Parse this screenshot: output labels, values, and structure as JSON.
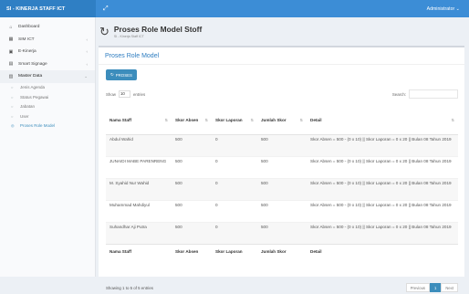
{
  "brand": "SI - KINERJA STAFF ICT",
  "navbar": {
    "toggle": "⤢",
    "user": "Administrator"
  },
  "sidebar": {
    "items": [
      {
        "label": "Dashboard",
        "icon": "home-icon",
        "glyph": "⌂"
      },
      {
        "label": "SIM ICT",
        "icon": "grid-icon",
        "glyph": "▦",
        "arrow": "‹"
      },
      {
        "label": "E-Kinerja",
        "icon": "chart-icon",
        "glyph": "▣",
        "arrow": "‹"
      },
      {
        "label": "Smart Signage",
        "icon": "monitor-icon",
        "glyph": "▤",
        "arrow": "‹"
      },
      {
        "label": "Master Data",
        "icon": "table-icon",
        "glyph": "▥",
        "arrow": "⌄"
      }
    ],
    "subitems": [
      {
        "label": "Jenis Agenda",
        "glyph": "○"
      },
      {
        "label": "Status Pegawai",
        "glyph": "○"
      },
      {
        "label": "Jabatan",
        "glyph": "○"
      },
      {
        "label": "User",
        "glyph": "○"
      },
      {
        "label": "Proses Role Model",
        "glyph": "◎"
      }
    ]
  },
  "header": {
    "title": "Proses Role Model Stoff",
    "breadcrumb": "SI - Kinerja Staff ICT"
  },
  "box": {
    "title": "Proses Role Model",
    "button": "PROSES",
    "button_icon": "↻"
  },
  "controls": {
    "show": "Show",
    "length": "10",
    "entries": "entries",
    "search": "Search:"
  },
  "table": {
    "headers": [
      "Nama Staff",
      "Skor Absen",
      "Skor Laporan",
      "Jumlah Skor",
      "Detail"
    ],
    "rows": [
      [
        "Abdul Wahid",
        "500",
        "0",
        "500",
        "Skor Absen = 500 - (0 x 10) || Skor Laporan = 0 x 20 || Bulan 08 Tahun 2019"
      ],
      [
        "JUNAIDI MABE PARENRENG",
        "500",
        "0",
        "500",
        "Skor Absen = 500 - (0 x 10) || Skor Laporan = 0 x 20 || Bulan 08 Tahun 2019"
      ],
      [
        "M. Syahid Nur Wahid",
        "500",
        "0",
        "500",
        "Skor Absen = 500 - (0 x 10) || Skor Laporan = 0 x 20 || Bulan 08 Tahun 2019"
      ],
      [
        "Muhammad Mahdiyul",
        "500",
        "0",
        "500",
        "Skor Absen = 500 - (0 x 10) || Skor Laporan = 0 x 20 || Bulan 08 Tahun 2019"
      ],
      [
        "Suhandhar Aji Putra",
        "500",
        "0",
        "500",
        "Skor Absen = 500 - (0 x 10) || Skor Laporan = 0 x 20 || Bulan 08 Tahun 2019"
      ]
    ]
  },
  "footer": {
    "info": "Showing 1 to 5 of 5 entries",
    "prev": "Previous",
    "page": "1",
    "next": "Next"
  }
}
